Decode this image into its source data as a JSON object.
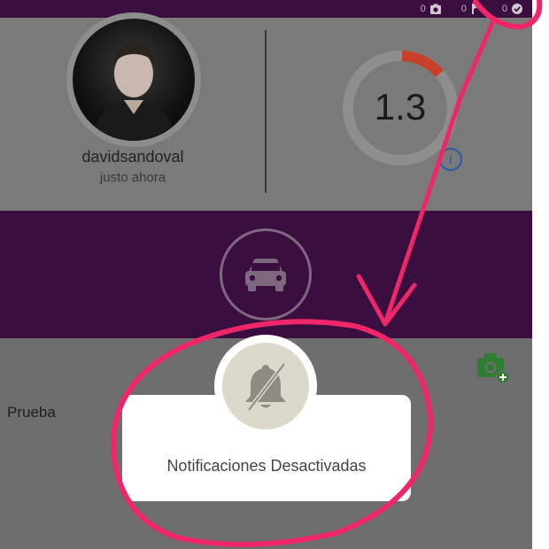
{
  "topbar": {
    "counters": [
      {
        "value": "0",
        "icon": "camera-icon"
      },
      {
        "value": "0",
        "icon": "flag-icon"
      },
      {
        "value": "0",
        "icon": "check-badge-icon"
      }
    ]
  },
  "profile": {
    "username": "davidsandoval",
    "last_seen": "justo ahora"
  },
  "score": {
    "value": "1.3",
    "info_icon": "info-icon",
    "progress_fraction": 0.13
  },
  "vehicle": {
    "icon": "car-icon"
  },
  "list": {
    "item_label": "Prueba",
    "add_photo_icon": "camera-add-icon"
  },
  "toast": {
    "message": "Notificaciones Desactivadas",
    "icon": "bell-slash-icon"
  },
  "colors": {
    "header_purple": "#3a0f3f",
    "annotation_pink": "#f0266a",
    "score_arc": "#c8402a",
    "info_blue": "#2b5aa8",
    "camera_green": "#2e7d32"
  }
}
